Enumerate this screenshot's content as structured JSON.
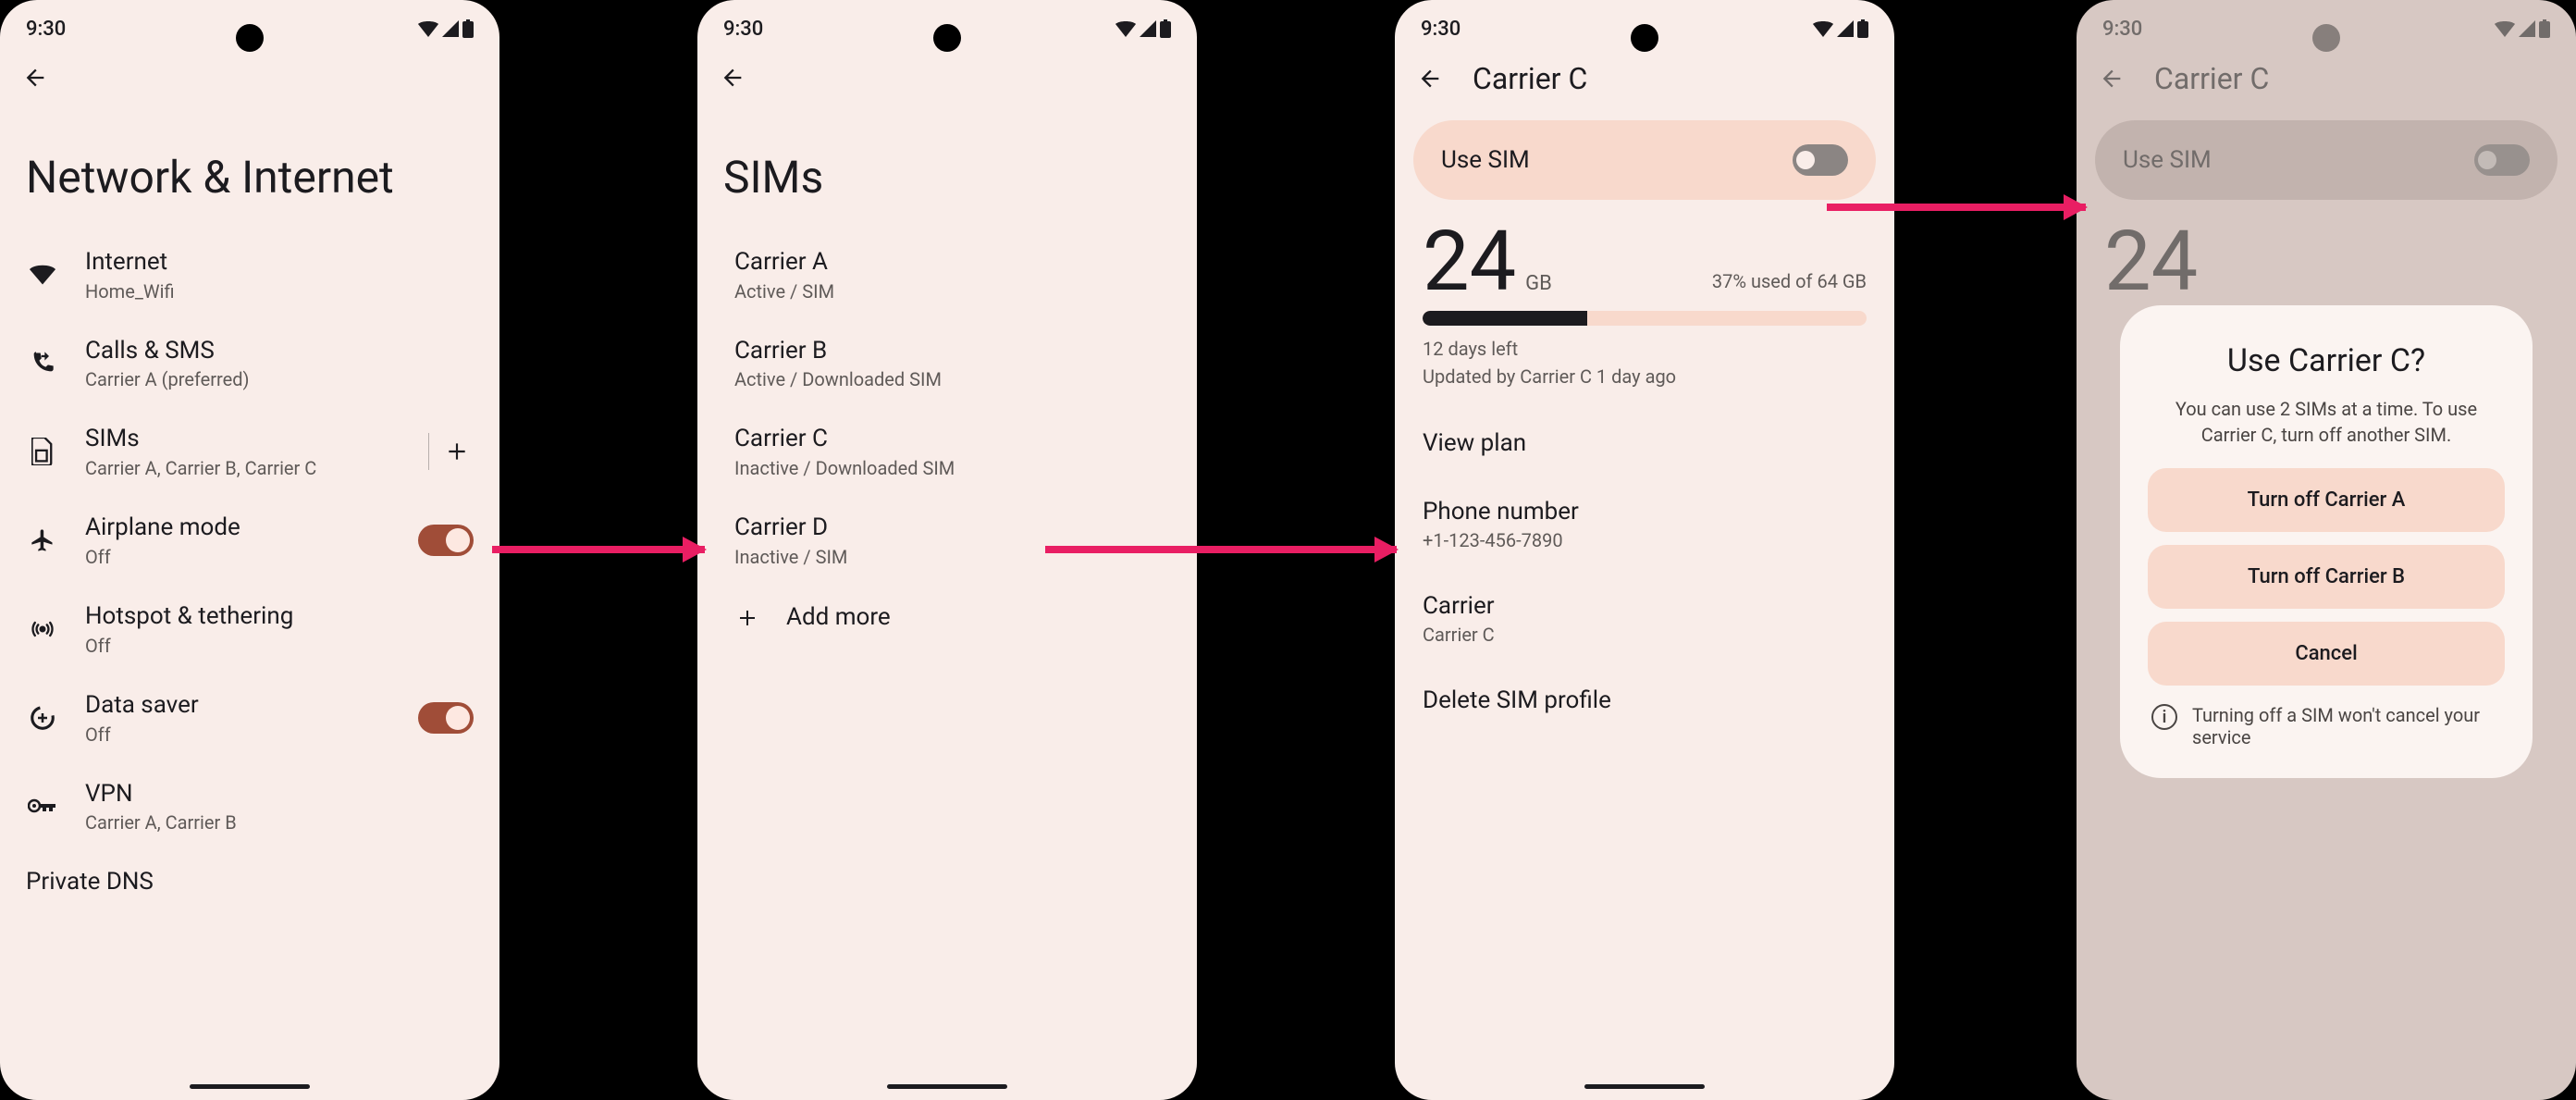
{
  "status": {
    "time": "9:30"
  },
  "screen1": {
    "title": "Network & Internet",
    "items": {
      "internet": {
        "title": "Internet",
        "sub": "Home_Wifi"
      },
      "calls": {
        "title": "Calls & SMS",
        "sub": "Carrier A (preferred)"
      },
      "sims": {
        "title": "SIMs",
        "sub": "Carrier A, Carrier B, Carrier C"
      },
      "airplane": {
        "title": "Airplane mode",
        "sub": "Off"
      },
      "hotspot": {
        "title": "Hotspot & tethering",
        "sub": "Off"
      },
      "datasaver": {
        "title": "Data saver",
        "sub": "Off"
      },
      "vpn": {
        "title": "VPN",
        "sub": "Carrier A, Carrier B"
      },
      "dns": {
        "title": "Private DNS"
      }
    }
  },
  "screen2": {
    "title": "SIMs",
    "sims": [
      {
        "title": "Carrier A",
        "sub": "Active / SIM"
      },
      {
        "title": "Carrier B",
        "sub": "Active / Downloaded SIM"
      },
      {
        "title": "Carrier C",
        "sub": "Inactive / Downloaded SIM"
      },
      {
        "title": "Carrier D",
        "sub": "Inactive / SIM"
      }
    ],
    "addmore": "Add more"
  },
  "screen3": {
    "title": "Carrier C",
    "use_sim": "Use SIM",
    "usage": {
      "amount": "24",
      "unit": "GB",
      "right": "37% used of 64 GB",
      "percent": 37,
      "line1": "12 days left",
      "line2": "Updated by Carrier C 1 day ago"
    },
    "rows": {
      "viewplan": {
        "title": "View plan"
      },
      "phone": {
        "title": "Phone number",
        "sub": "+1-123-456-7890"
      },
      "carrier": {
        "title": "Carrier",
        "sub": "Carrier C"
      },
      "delete": {
        "title": "Delete SIM profile"
      }
    }
  },
  "screen4": {
    "title": "Carrier C",
    "use_sim": "Use SIM",
    "usage_amount": "24",
    "dialog": {
      "title": "Use Carrier C?",
      "body": "You can use 2 SIMs at a time. To use Carrier C, turn off another SIM.",
      "btn_a": "Turn off Carrier A",
      "btn_b": "Turn off Carrier B",
      "btn_cancel": "Cancel",
      "info": "Turning off a SIM won't cancel your service"
    }
  }
}
